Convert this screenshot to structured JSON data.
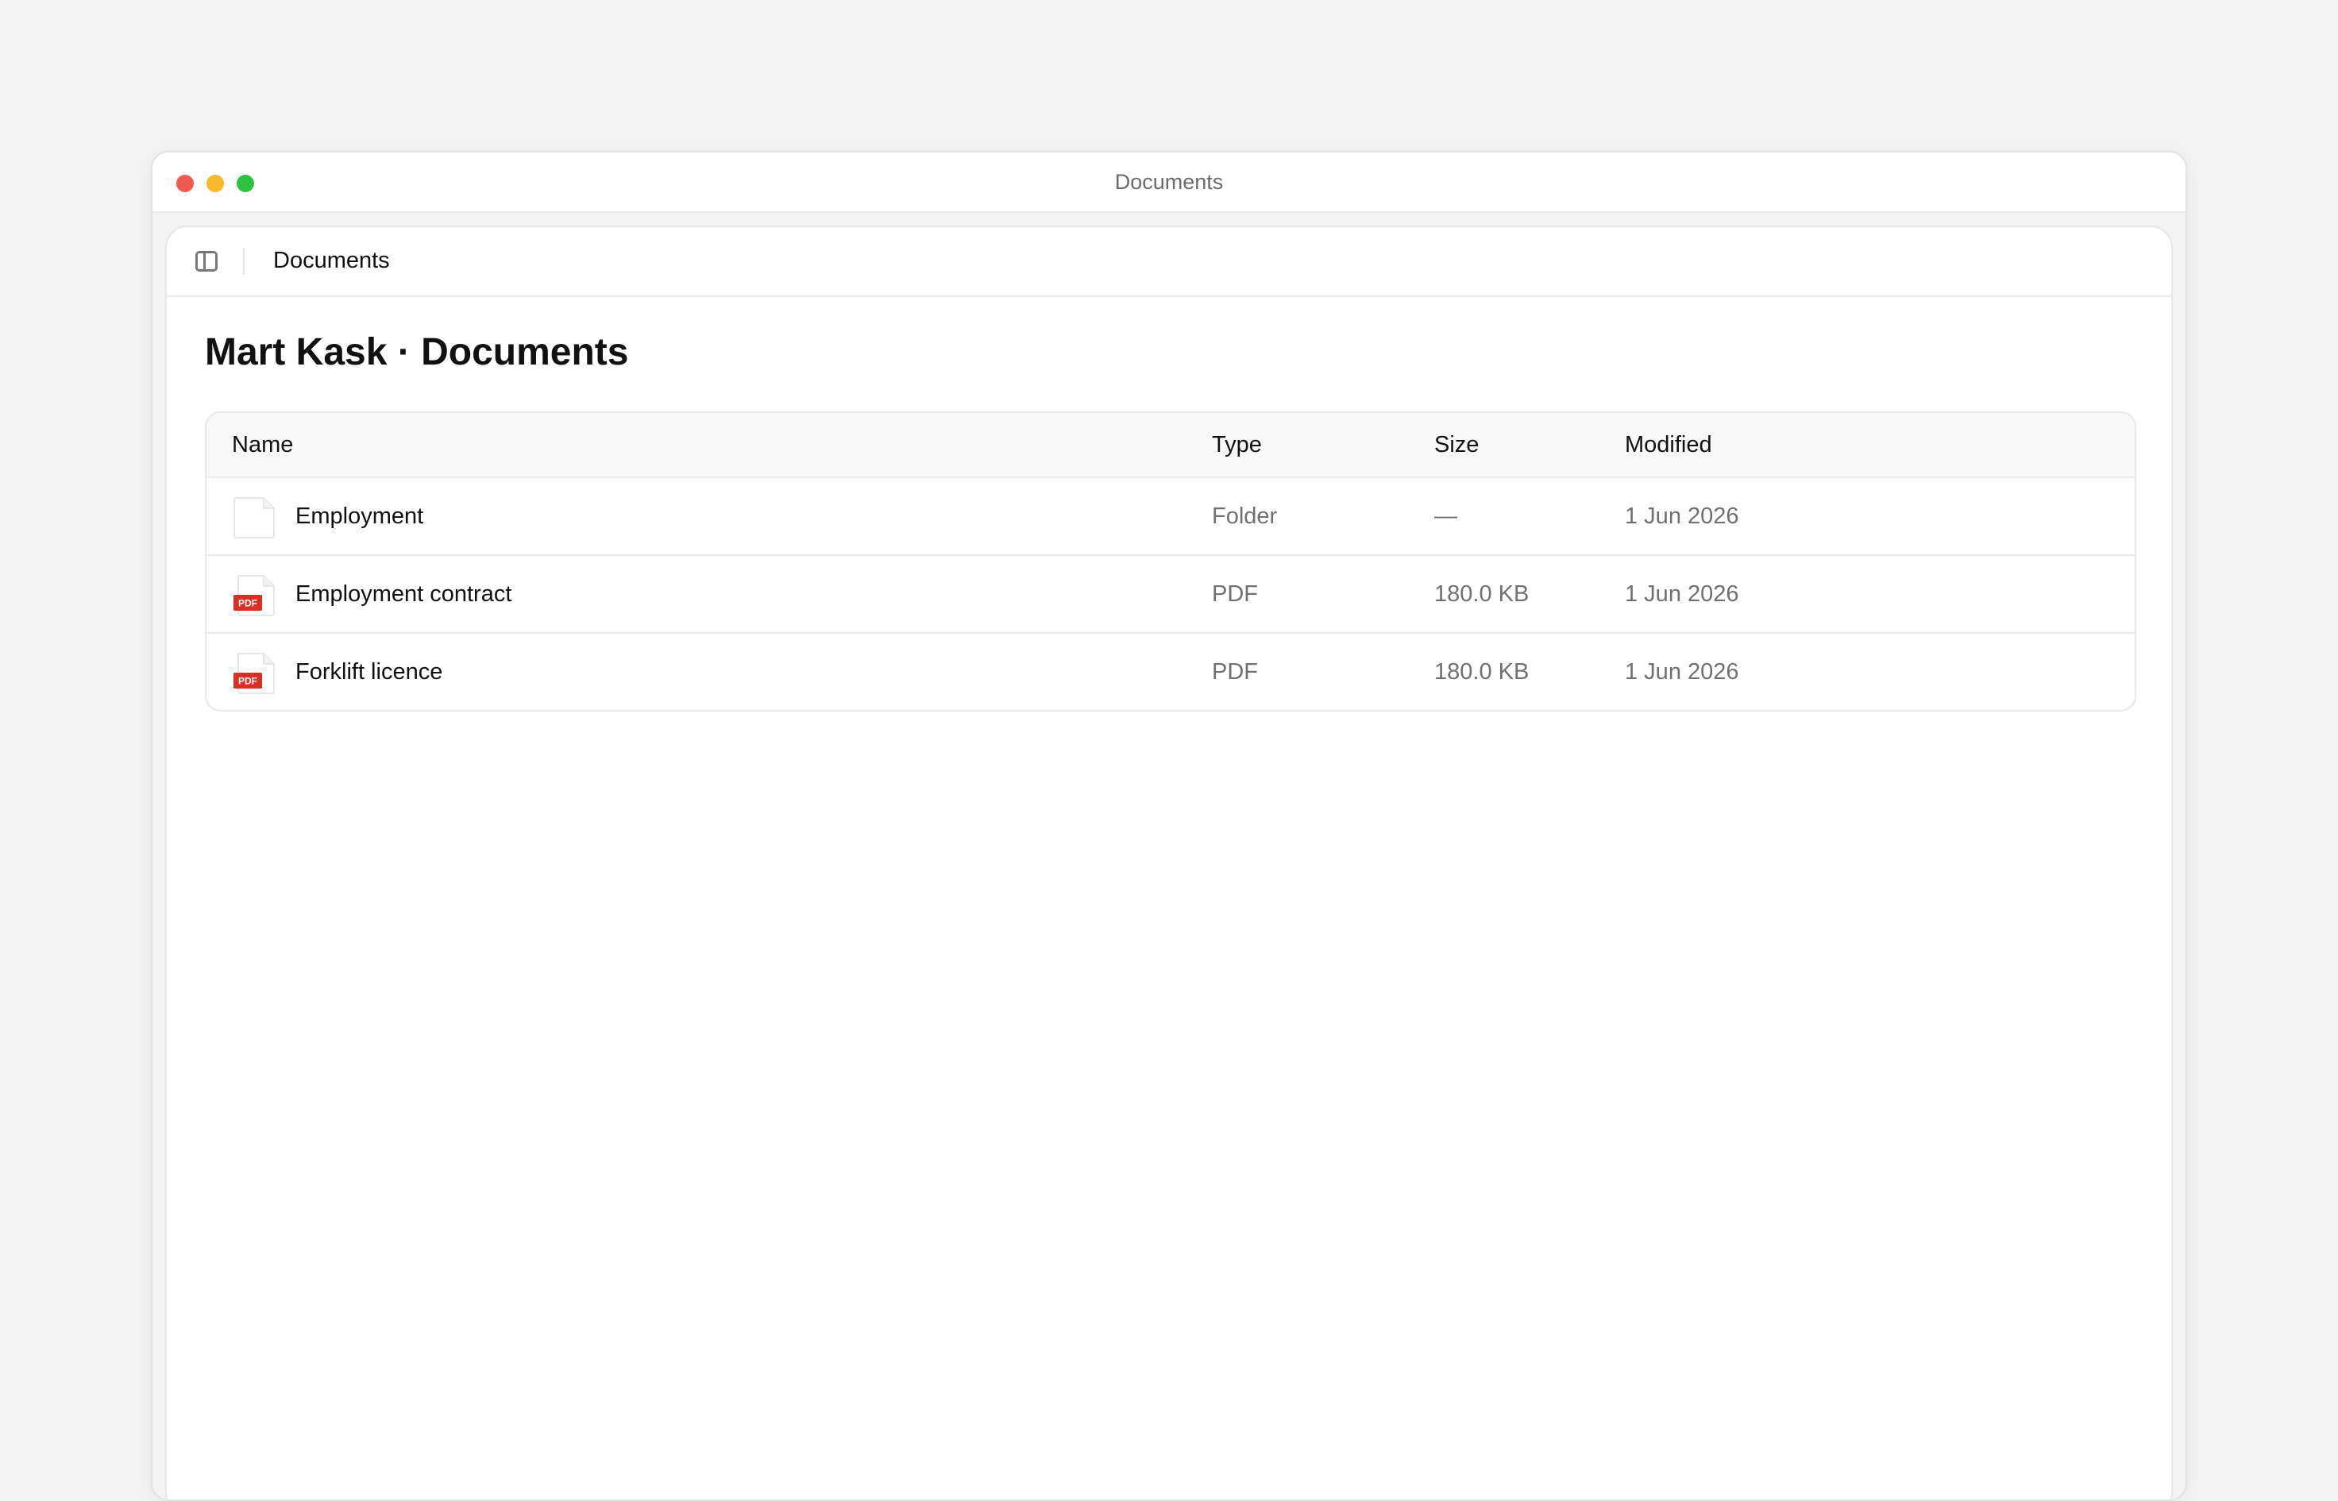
{
  "window": {
    "title": "Documents"
  },
  "toolbar": {
    "breadcrumb": "Documents"
  },
  "page": {
    "title": "Mart Kask · Documents"
  },
  "table": {
    "columns": [
      "Name",
      "Type",
      "Size",
      "Modified"
    ],
    "rows": [
      {
        "name": "Employment",
        "type": "Folder",
        "size": "—",
        "modified": "1 Jun 2026",
        "icon": "folder-icon"
      },
      {
        "name": "Employment contract",
        "type": "PDF",
        "size": "180.0 KB",
        "modified": "1 Jun 2026",
        "icon": "pdf-icon"
      },
      {
        "name": "Forklift licence",
        "type": "PDF",
        "size": "180.0 KB",
        "modified": "1 Jun 2026",
        "icon": "pdf-icon"
      }
    ]
  },
  "icons": {
    "pdf_badge": "PDF"
  },
  "colors": {
    "pdf_badge": "#d93025",
    "close": "#ee5a52",
    "minimize": "#f5b92b",
    "maximize": "#2dc140"
  }
}
